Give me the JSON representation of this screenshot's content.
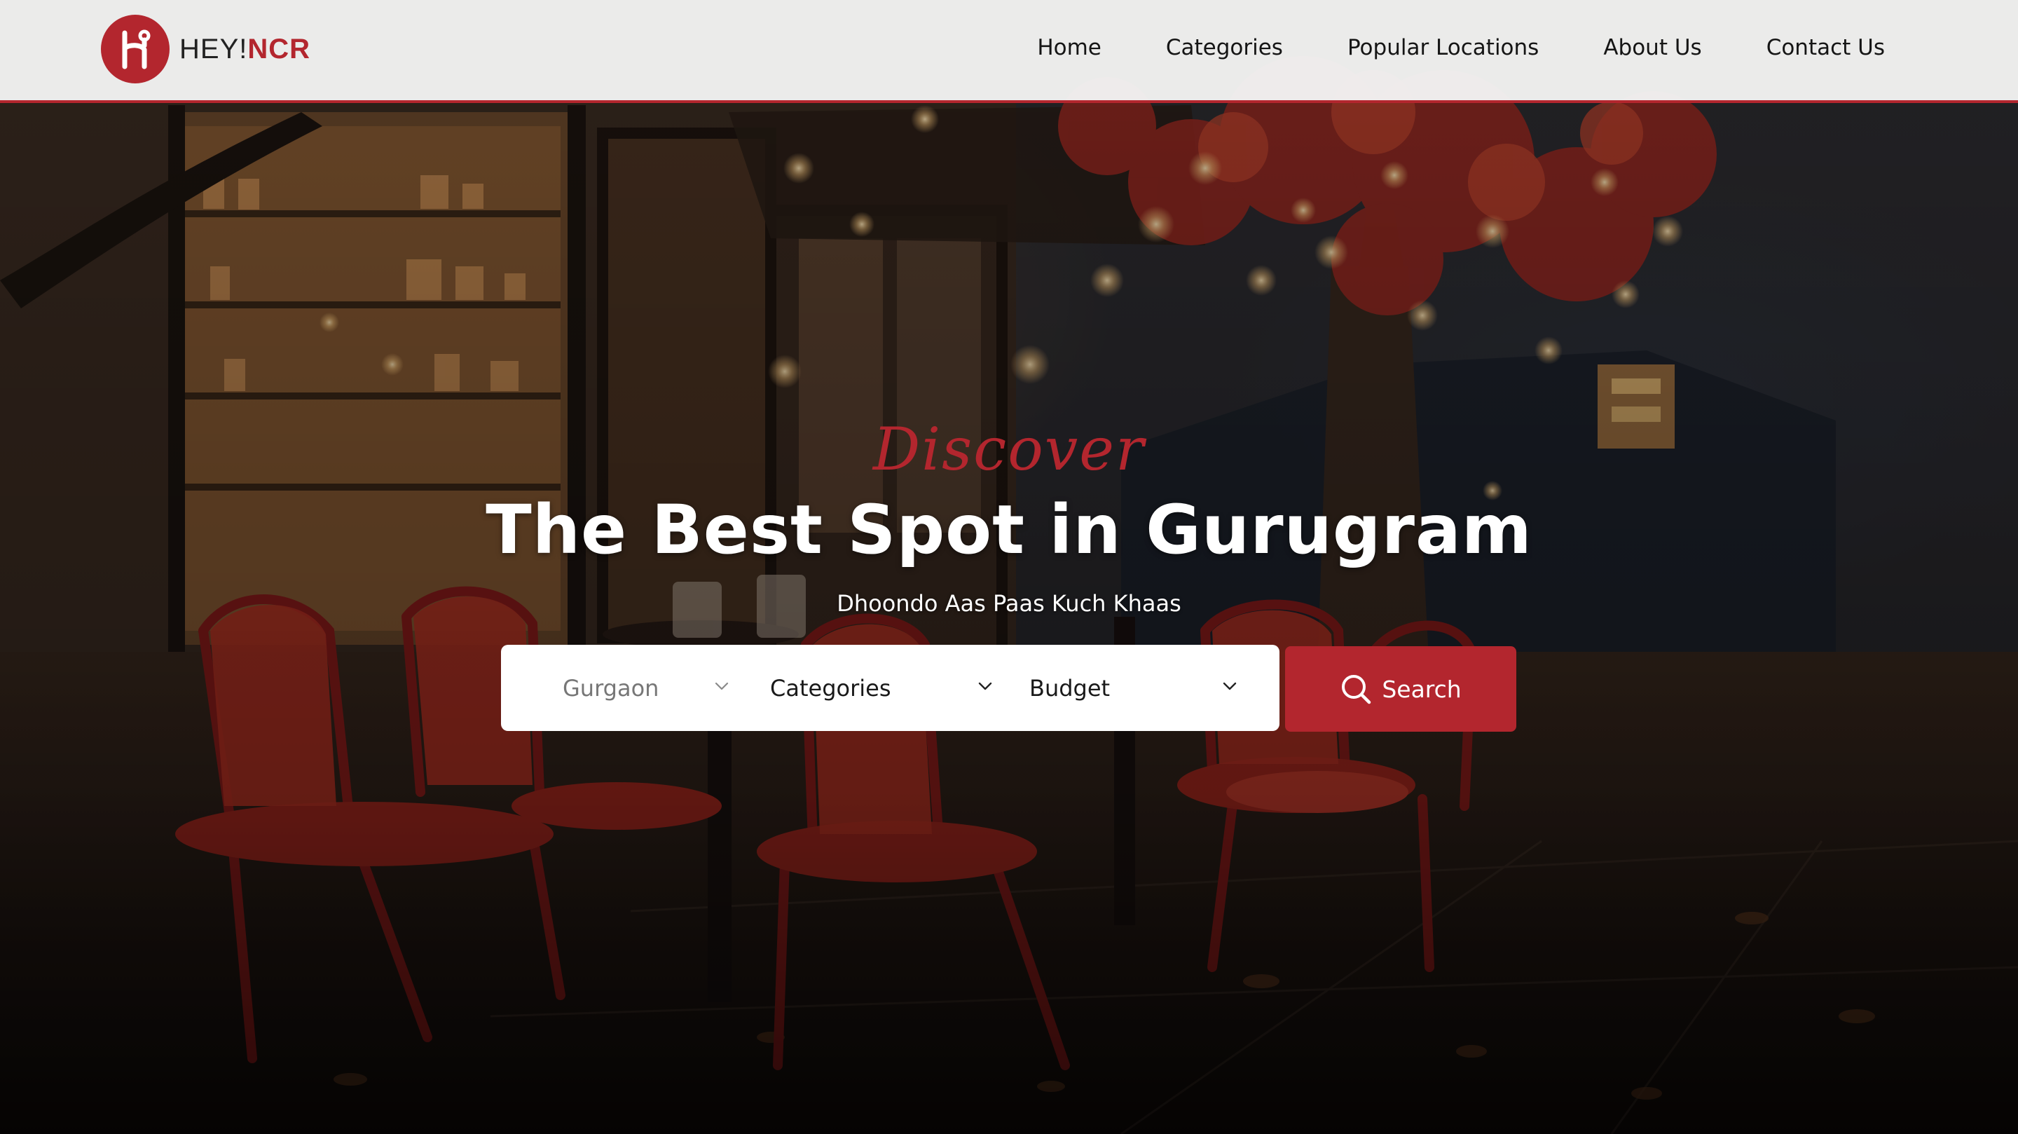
{
  "brand": {
    "logo_icon": "hey-ncr-logo-icon",
    "name_light": "HEY!",
    "name_bold": "NCR",
    "accent_color": "#b3262e"
  },
  "nav": {
    "items": [
      {
        "label": "Home"
      },
      {
        "label": "Categories"
      },
      {
        "label": "Popular Locations"
      },
      {
        "label": "About Us"
      },
      {
        "label": "Contact Us"
      }
    ]
  },
  "hero": {
    "eyebrow": "Discover",
    "title": "The Best Spot in Gurugram",
    "subtitle": "Dhoondo Aas Paas Kuch Khaas",
    "background_image": "night-cafe-terrace-red-chairs"
  },
  "search": {
    "location": {
      "value": "Gurgaon",
      "icon": "chevron-down-icon"
    },
    "category": {
      "value": "Categories",
      "icon": "chevron-down-icon"
    },
    "budget": {
      "value": "Budget",
      "icon": "chevron-down-icon"
    },
    "button": {
      "label": "Search",
      "icon": "search-icon"
    }
  }
}
